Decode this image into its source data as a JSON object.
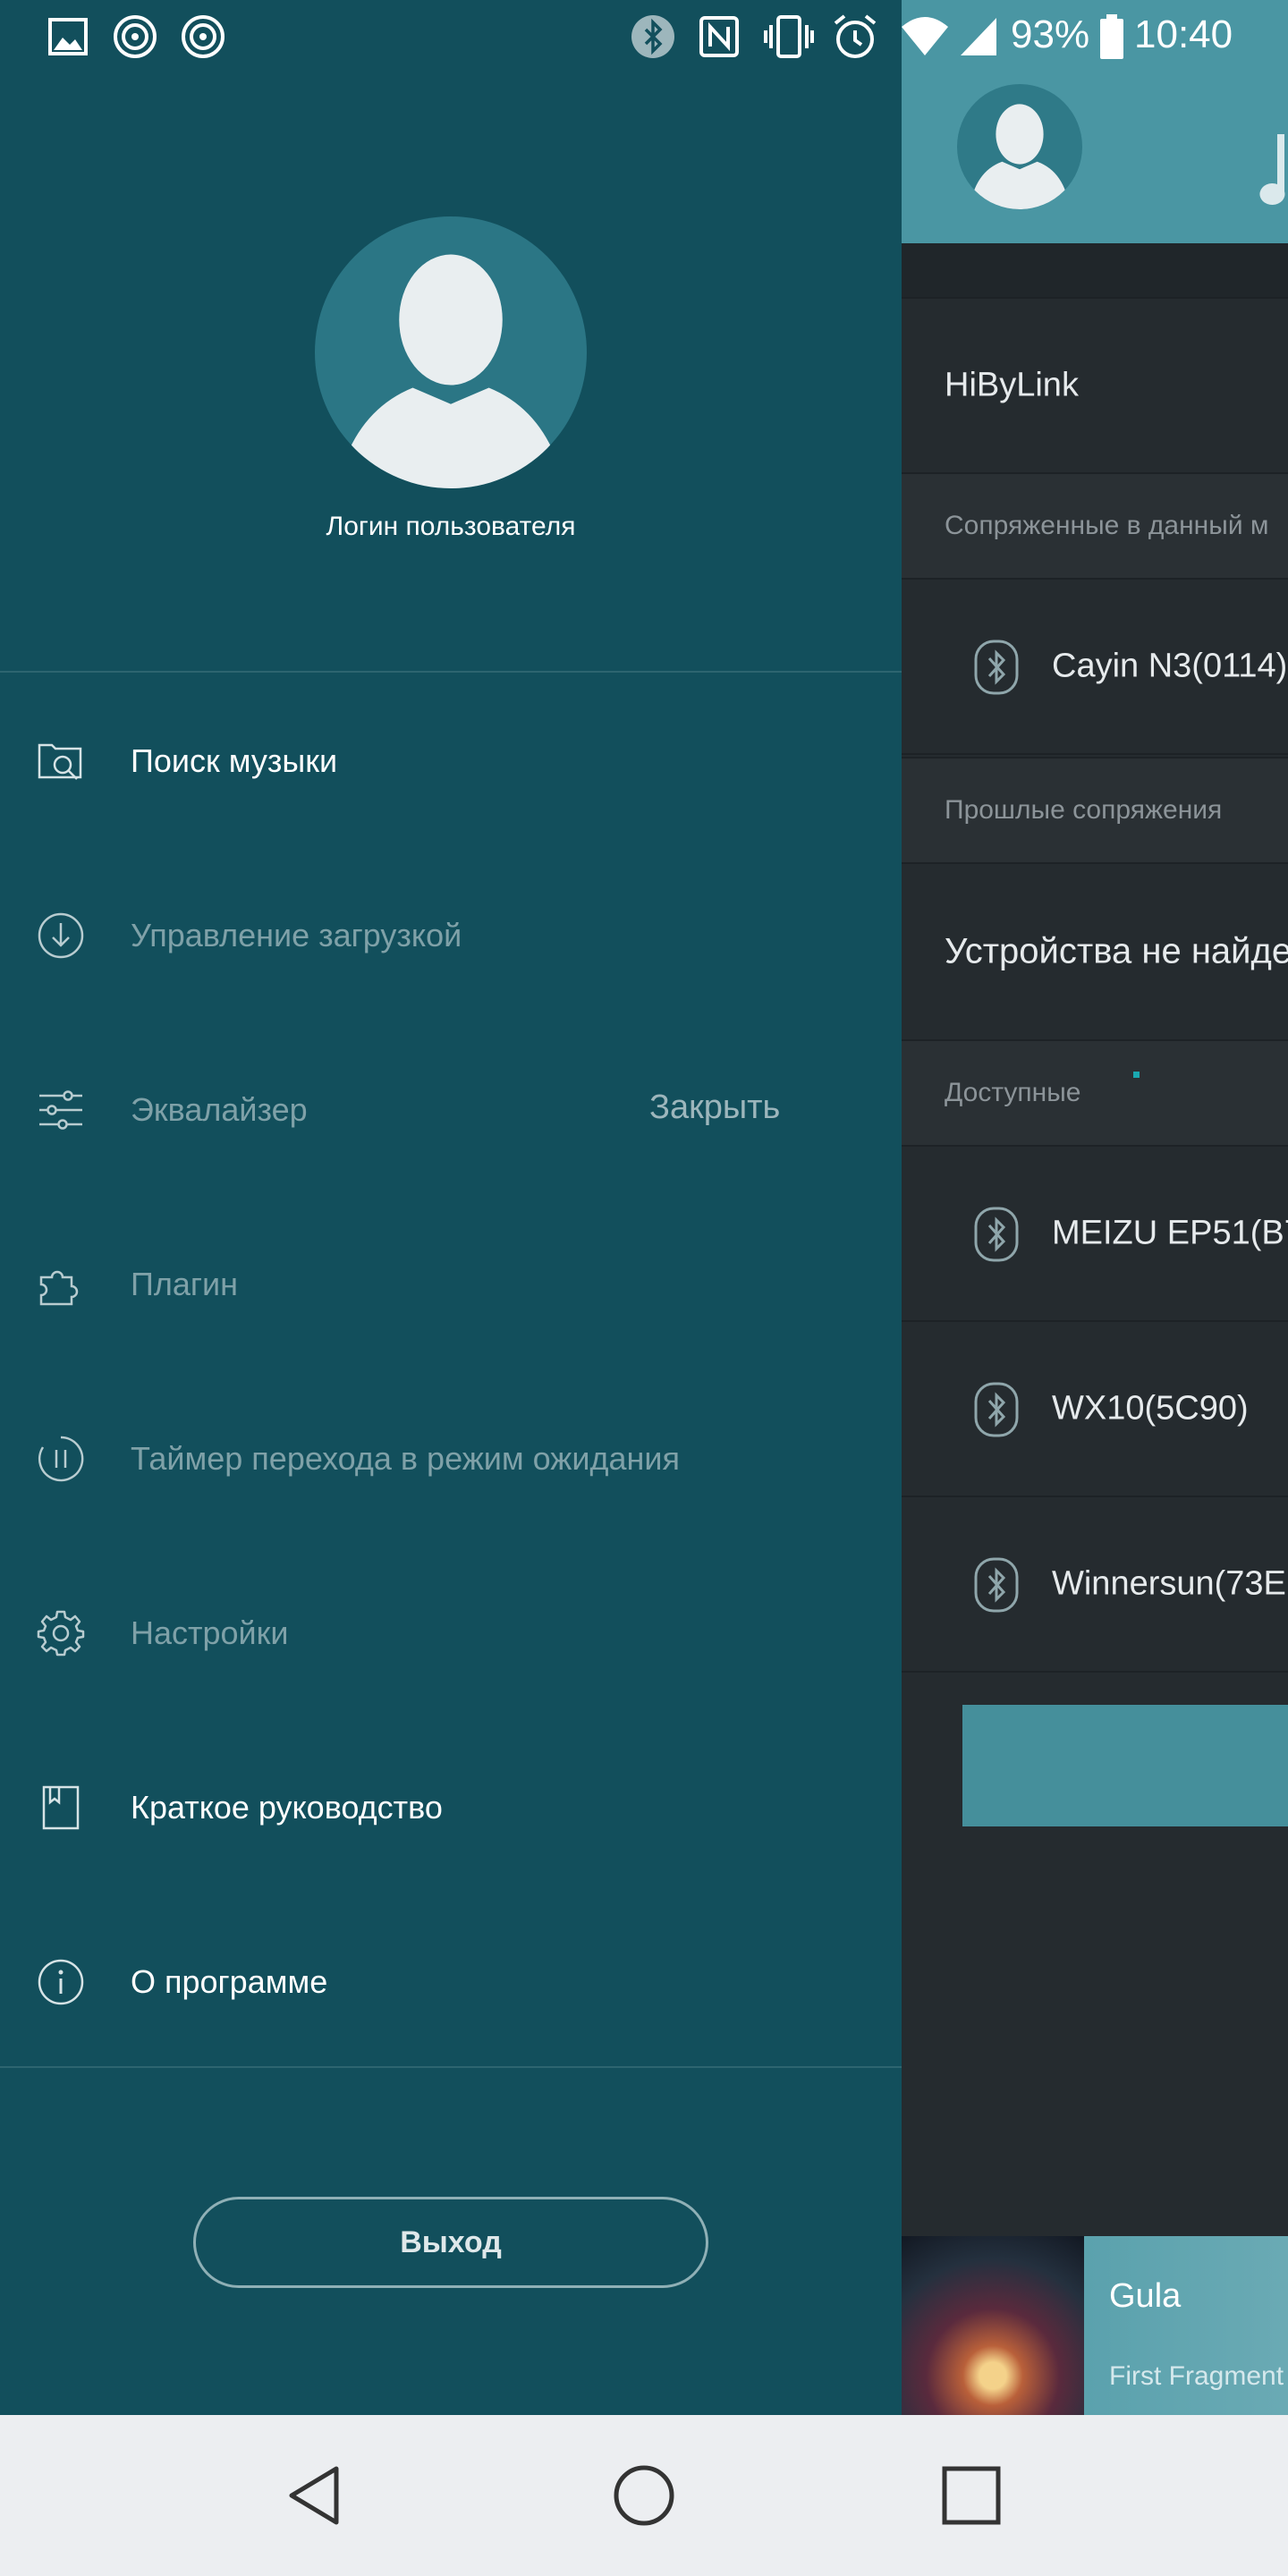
{
  "status_bar": {
    "battery": "93%",
    "time": "10:40",
    "icons": [
      "image-icon",
      "podcast-icon",
      "podcast-icon",
      "bluetooth-icon",
      "nfc-icon",
      "vibrate-icon",
      "alarm-icon",
      "wifi-icon",
      "signal-icon",
      "battery-icon"
    ]
  },
  "drawer": {
    "user_login": "Логин пользователя",
    "menu": [
      {
        "label": "Поиск музыки",
        "icon": "music-search-icon",
        "active": true
      },
      {
        "label": "Управление загрузкой",
        "icon": "download-icon",
        "active": false
      },
      {
        "label": "Эквалайзер",
        "icon": "equalizer-icon",
        "active": false
      },
      {
        "label": "Плагин",
        "icon": "plugin-icon",
        "active": false
      },
      {
        "label": "Таймер перехода в режим ожидания",
        "icon": "sleep-timer-icon",
        "active": false
      },
      {
        "label": "Настройки",
        "icon": "settings-icon",
        "active": false
      },
      {
        "label": "Краткое руководство",
        "icon": "guide-icon",
        "active": true
      },
      {
        "label": "О программе",
        "icon": "info-icon",
        "active": true
      }
    ],
    "close_label": "Закрыть",
    "logout_label": "Выход"
  },
  "main": {
    "title": "HiByLink",
    "paired_section": "Сопряженные в данный м",
    "paired_devices": [
      "Cayin N3(0114)"
    ],
    "past_section": "Прошлые сопряжения",
    "no_devices": "Устройства не найде",
    "available_section": "Доступные",
    "available_devices": [
      "MEIZU EP51(B7",
      "WX10(5C90)",
      "Winnersun(73E"
    ]
  },
  "player": {
    "title": "Gula",
    "artist": "First Fragment"
  },
  "colors": {
    "drawer_bg": "#124f5c",
    "header_accent": "#4a96a3",
    "main_bg": "#252b2f"
  }
}
